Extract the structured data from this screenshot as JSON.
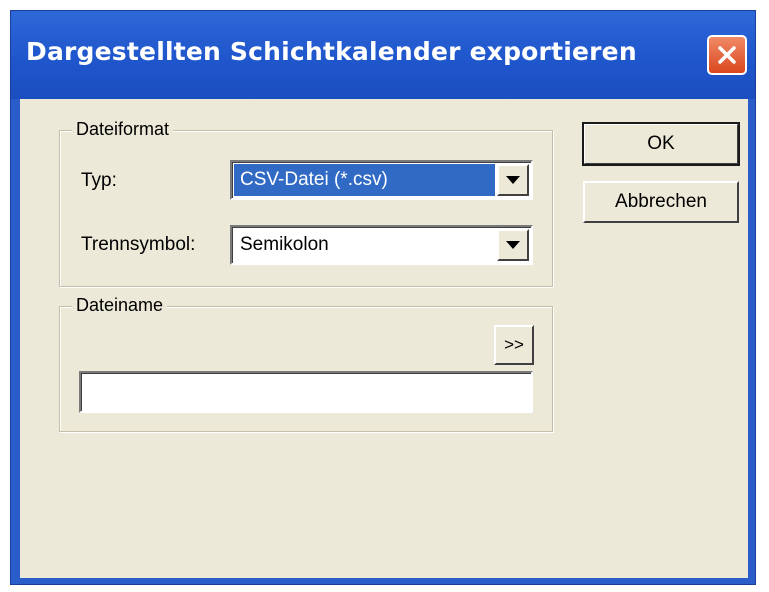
{
  "window": {
    "title": "Dargestellten Schichtkalender exportieren"
  },
  "dateiformat": {
    "legend": "Dateiformat",
    "typ_label": "Typ:",
    "typ_value": "CSV-Datei (*.csv)",
    "trenn_label": "Trennsymbol:",
    "trenn_value": "Semikolon"
  },
  "dateiname": {
    "legend": "Dateiname",
    "browse_label": ">>",
    "value": ""
  },
  "buttons": {
    "ok_label": "OK",
    "cancel_label": "Abbrechen"
  },
  "colors": {
    "title_bar": "#2a5dc9",
    "selection": "#316ac5",
    "dialog_face": "#ece9d8",
    "close_button": "#e0552c"
  },
  "icons": {
    "close": "close-icon",
    "dropdown": "chevron-down-icon"
  }
}
